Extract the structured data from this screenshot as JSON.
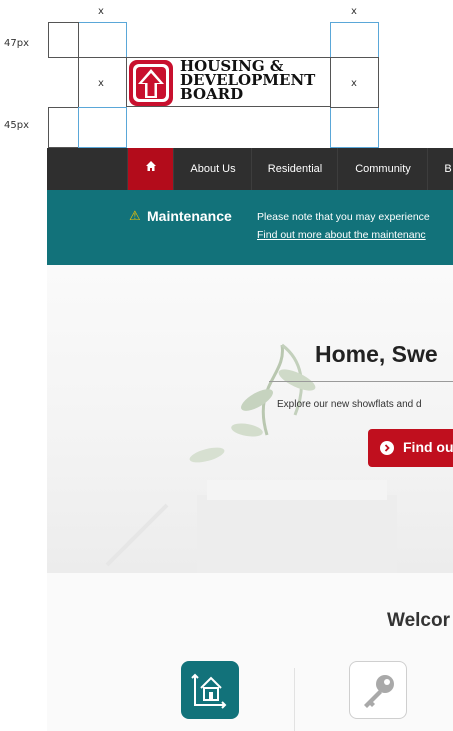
{
  "guides": {
    "x_label": "x",
    "top_px": "47px",
    "bottom_px": "45px"
  },
  "logo": {
    "line1": "HOUSING &",
    "line2": "DEVELOPMENT",
    "line3": "BOARD"
  },
  "nav": {
    "items": [
      {
        "label": "About Us"
      },
      {
        "label": "Residential"
      },
      {
        "label": "Community"
      },
      {
        "label": "B"
      }
    ]
  },
  "maintenance": {
    "title": "Maintenance",
    "message": "Please note that you may experience",
    "link": "Find out more about the maintenanc"
  },
  "hero": {
    "title": "Home, Swe",
    "subtitle": "Explore our new showflats and d",
    "cta": "Find ou"
  },
  "welcome": {
    "title": "Welcor"
  },
  "colors": {
    "nav_bg": "#2f2f2f",
    "home_red": "#b30c1b",
    "teal": "#12727a",
    "cta_red": "#c00f1e"
  }
}
